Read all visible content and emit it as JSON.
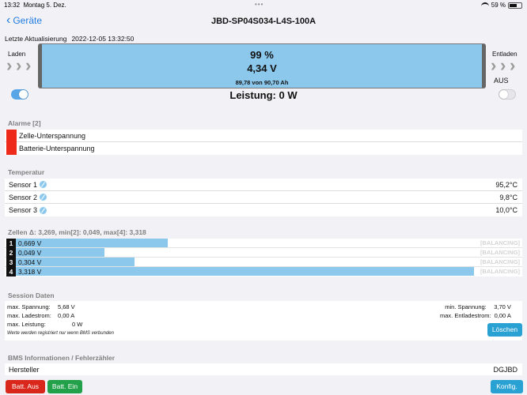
{
  "statusbar": {
    "time": "13:32",
    "date": "Montag 5. Dez.",
    "dots": "•••",
    "battery_pct": "59 %"
  },
  "nav": {
    "back_label": "Geräte",
    "title": "JBD-SP04S034-L4S-100A"
  },
  "update": {
    "label": "Letzte Aktualisierung",
    "value": "2022-12-05 13:32:50"
  },
  "battery": {
    "charge_label": "Laden",
    "discharge_label": "Entladen",
    "percent": "99 %",
    "voltage": "4,34 V",
    "capacity": "89,78 von 90,70 Ah",
    "discharge_state": "AUS",
    "charge_toggle_on": true,
    "discharge_toggle_on": false
  },
  "power": "Leistung: 0 W",
  "alarms": {
    "header": "Alarme [2]",
    "items": [
      "Zelle-Unterspannung",
      "Batterie-Unterspannung"
    ],
    "flag_color": "#ee2a1b"
  },
  "temperature": {
    "header": "Temperatur",
    "sensors": [
      {
        "name": "Sensor 1",
        "value": "95,2°C"
      },
      {
        "name": "Sensor 2",
        "value": "9,8°C"
      },
      {
        "name": "Sensor 3",
        "value": "10,0°C"
      }
    ]
  },
  "cells": {
    "header": "Zellen Δ: 3,269, min[2]: 0,049, max[4]: 3,318",
    "balancing_label": "[BALANCING]",
    "items": [
      {
        "index": "1",
        "value": "0,669 V",
        "level": 0.3
      },
      {
        "index": "2",
        "value": "0,049 V",
        "level": 0.175
      },
      {
        "index": "3",
        "value": "0,304 V",
        "level": 0.235
      },
      {
        "index": "4",
        "value": "3,318 V",
        "level": 0.905
      }
    ]
  },
  "session": {
    "header": "Session Daten",
    "left": [
      {
        "label": "max. Spannung:",
        "value": "5,68 V"
      },
      {
        "label": "max. Ladestrom:",
        "value": "0,00 A"
      },
      {
        "label": "max. Leistung:",
        "value": "0 W"
      }
    ],
    "right": [
      {
        "label": "min. Spannung:",
        "value": "3,70 V"
      },
      {
        "label": "max. Entladestrom:",
        "value": "0,00 A"
      }
    ],
    "note": "Werte werden registriert nur wenn BMS verbunden",
    "clear_label": "Löschen"
  },
  "bms": {
    "header": "BMS Informationen / Fehlerzähler",
    "rows": [
      {
        "label": "Hersteller",
        "value": "DGJBD"
      }
    ]
  },
  "footer": {
    "batt_off": "Batt. Aus",
    "batt_on": "Batt. Ein",
    "config": "Konfig."
  },
  "colors": {
    "accent": "#1f7ae0",
    "bar": "#8cc8ec",
    "red": "#d9271b",
    "green": "#23a04a",
    "button_blue": "#2aa1d3"
  }
}
